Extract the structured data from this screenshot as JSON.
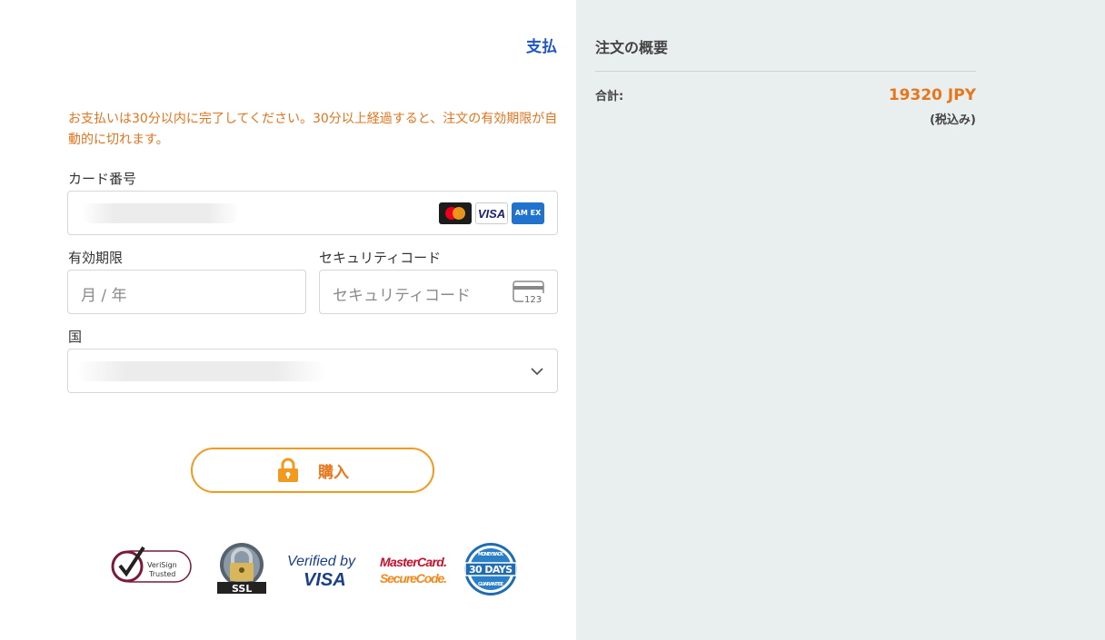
{
  "payment": {
    "title": "支払",
    "warning": "お支払いは30分以内に完了してください。30分以上経過すると、注文の有効期限が自動的に切れます。",
    "card_number_label": "カード番号",
    "card_brands": [
      "mastercard-icon",
      "visa-icon",
      "amex-icon"
    ],
    "visa_text": "VISA",
    "amex_text": "AM EX",
    "expiry_label": "有効期限",
    "expiry_placeholder": "月 / 年",
    "security_label": "セキュリティコード",
    "security_placeholder": "セキュリティコード",
    "cvc_icon_text": "123",
    "country_label": "国",
    "buy_button": "購入",
    "trust_badges": {
      "verisign": [
        "VeriSign",
        "Trusted"
      ],
      "ssl": "SSL",
      "verified_by": "Verified by",
      "verified_visa": "VISA",
      "mastercard": "MasterCard.",
      "securecode": "SecureCode.",
      "days": "30 DAYS",
      "money_back": "MONEY BACK",
      "guarantee": "GUARANTEE"
    }
  },
  "summary": {
    "title": "注文の概要",
    "total_label": "合計:",
    "total_amount": "19320 JPY",
    "tax_note": "(税込み)"
  },
  "colors": {
    "accent": "#e8761b",
    "link_blue": "#1f56c4",
    "panel_bg": "#e9eeee"
  }
}
